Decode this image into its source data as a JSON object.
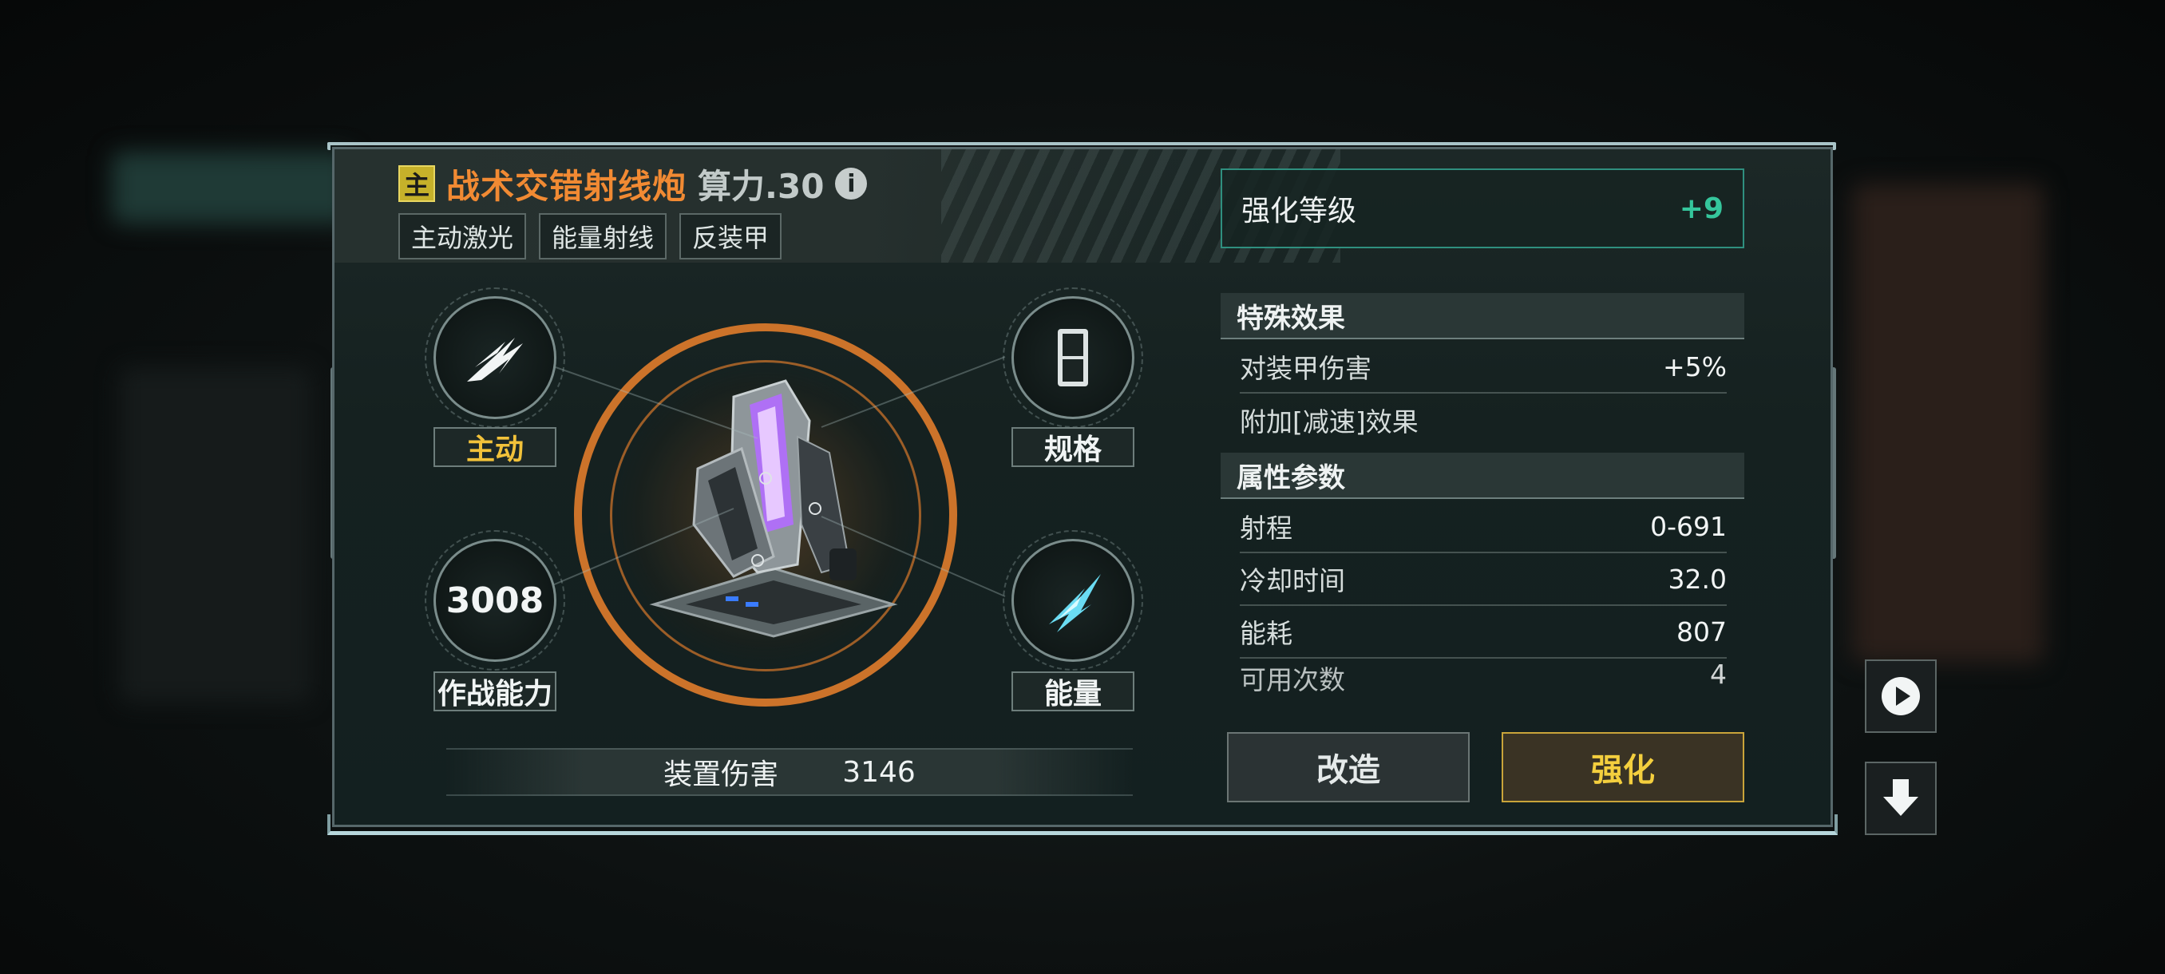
{
  "weapon": {
    "slot_badge": "主",
    "name": "战术交错射线炮",
    "power_text": "算力.30",
    "tags": [
      "主动激光",
      "能量射线",
      "反装甲"
    ]
  },
  "nodes": {
    "active_label": "主动",
    "spec_label": "规格",
    "combat_value": "3008",
    "combat_label": "作战能力",
    "energy_label": "能量"
  },
  "damage": {
    "label": "装置伤害",
    "value": "3146"
  },
  "enhance": {
    "label": "强化等级",
    "value": "+9"
  },
  "special_effects": {
    "title": "特殊效果",
    "rows": [
      {
        "label": "对装甲伤害",
        "value": "+5%"
      },
      {
        "label": "附加[减速]效果",
        "value": ""
      }
    ]
  },
  "attributes": {
    "title": "属性参数",
    "rows": [
      {
        "label": "射程",
        "value": "0-691"
      },
      {
        "label": "冷却时间",
        "value": "32.0"
      },
      {
        "label": "能耗",
        "value": "807"
      },
      {
        "label": "可用次数",
        "value": "4"
      }
    ]
  },
  "buttons": {
    "modify": "改造",
    "enhance": "强化"
  },
  "colors": {
    "title_orange": "#f18a33",
    "gold": "#f2c23a",
    "enhance_green": "#35c69c",
    "ring_orange": "#d6782b"
  },
  "icons": {
    "active": "claw-slash-icon",
    "spec": "module-spec-icon",
    "energy": "energy-bolt-icon",
    "info": "info-icon",
    "play": "play-icon",
    "download": "download-arrow-icon"
  }
}
